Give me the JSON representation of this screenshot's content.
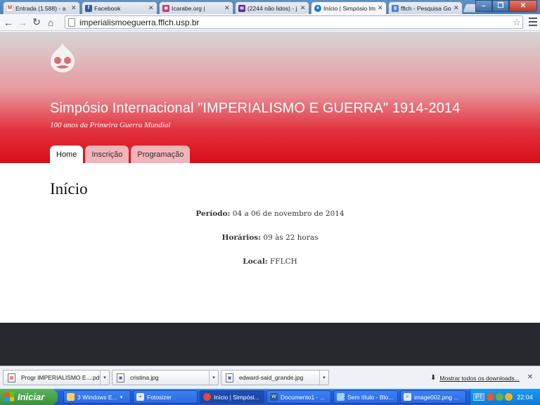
{
  "browser": {
    "tabs": [
      {
        "title": "Entrada (1.588) - a",
        "icon": "gmail-icon",
        "active": false
      },
      {
        "title": "Facebook",
        "icon": "facebook-icon",
        "active": false
      },
      {
        "title": "Icarabe.org |",
        "icon": "icarabe-icon",
        "active": false
      },
      {
        "title": "(2244 não lidos) - j",
        "icon": "yahoo-mail-icon",
        "active": false
      },
      {
        "title": "Início | Simpósio Im",
        "icon": "drupal-icon",
        "active": true
      },
      {
        "title": "fflch - Pesquisa Go",
        "icon": "google-icon",
        "active": false
      }
    ],
    "url": "imperialismoeguerra.fflch.usp.br",
    "window_controls": {
      "minimize": "–",
      "maximize": "❐",
      "close": "✕"
    }
  },
  "page": {
    "site_title": "Simpósio Internacional \"IMPERIALISMO E GUERRA\" 1914-2014",
    "slogan": "100 anos da Primeira Guerra Mundial",
    "nav": [
      {
        "label": "Home",
        "active": true
      },
      {
        "label": "Inscrição",
        "active": false
      },
      {
        "label": "Programação",
        "active": false
      }
    ],
    "heading": "Início",
    "info": [
      {
        "label": "Período:",
        "value": " 04 a 06 de novembro de 2014"
      },
      {
        "label": "Horários:",
        "value": " 09 às 22 horas"
      },
      {
        "label": "Local:",
        "value": " FFLCH"
      }
    ],
    "colors": {
      "header_red": "#d70e18",
      "tab_pink": "#f2b4b8",
      "footer": "#262a2f"
    }
  },
  "downloads": {
    "items": [
      {
        "name": "Progr IMPERIALISMO E....pdf",
        "icon": "pdf-icon"
      },
      {
        "name": "cristina.jpg",
        "icon": "image-file-icon"
      },
      {
        "name": "edward-said_grande.jpg",
        "icon": "image-file-icon"
      }
    ],
    "show_all": "Mostrar todos os downloads...",
    "close": "✕"
  },
  "taskbar": {
    "start_label": "Iniciar",
    "buttons": [
      {
        "label": "3 Windows E...",
        "icon": "folder-icon",
        "active": false
      },
      {
        "label": "Fotosizer",
        "icon": "fotosizer-icon",
        "active": false
      },
      {
        "label": "Início | Simpósi...",
        "icon": "chrome-icon",
        "active": true
      },
      {
        "label": "Documento1 - ...",
        "icon": "word-icon",
        "active": false
      },
      {
        "label": "Sem título - Blo...",
        "icon": "notepad-icon",
        "active": false
      },
      {
        "label": "image002.png ...",
        "icon": "image-viewer-icon",
        "active": false
      }
    ],
    "language": "PT",
    "clock": "22:04"
  }
}
